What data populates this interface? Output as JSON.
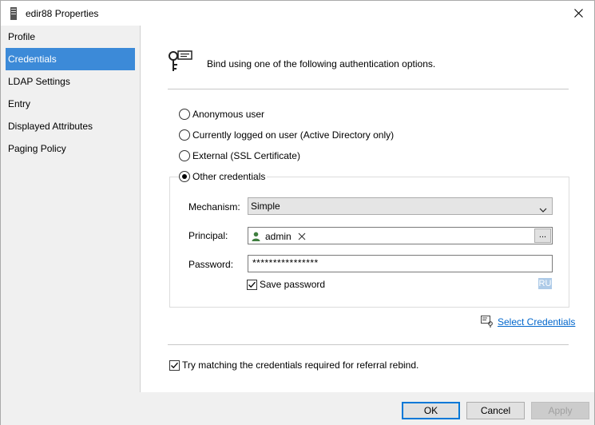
{
  "window": {
    "title": "edir88 Properties"
  },
  "sidebar": {
    "items": [
      {
        "label": "Profile"
      },
      {
        "label": "Credentials",
        "active": true
      },
      {
        "label": "LDAP Settings"
      },
      {
        "label": "Entry"
      },
      {
        "label": "Displayed Attributes"
      },
      {
        "label": "Paging Policy"
      }
    ]
  },
  "content": {
    "intro": "Bind using one of the following authentication options.",
    "options": [
      {
        "label": "Anonymous user",
        "checked": false
      },
      {
        "label": "Currently logged on user (Active Directory only)",
        "checked": false
      },
      {
        "label": "External (SSL Certificate)",
        "checked": false
      },
      {
        "label": "Other credentials",
        "checked": true
      }
    ],
    "mechanism": {
      "label": "Mechanism:",
      "value": "Simple"
    },
    "principal": {
      "label": "Principal:",
      "value": "admin",
      "browse": "..."
    },
    "password": {
      "label": "Password:",
      "value": "****************"
    },
    "save_password": {
      "label": "Save password",
      "checked": true
    },
    "input_language": "RU",
    "select_credentials": "Select Credentials",
    "referral": {
      "label": "Try matching the credentials required for referral rebind.",
      "checked": true
    }
  },
  "footer": {
    "ok": "OK",
    "cancel": "Cancel",
    "apply": "Apply"
  },
  "colors": {
    "accent": "#3c8ad8",
    "link": "#0066cc",
    "panel": "#f0f0f0"
  }
}
